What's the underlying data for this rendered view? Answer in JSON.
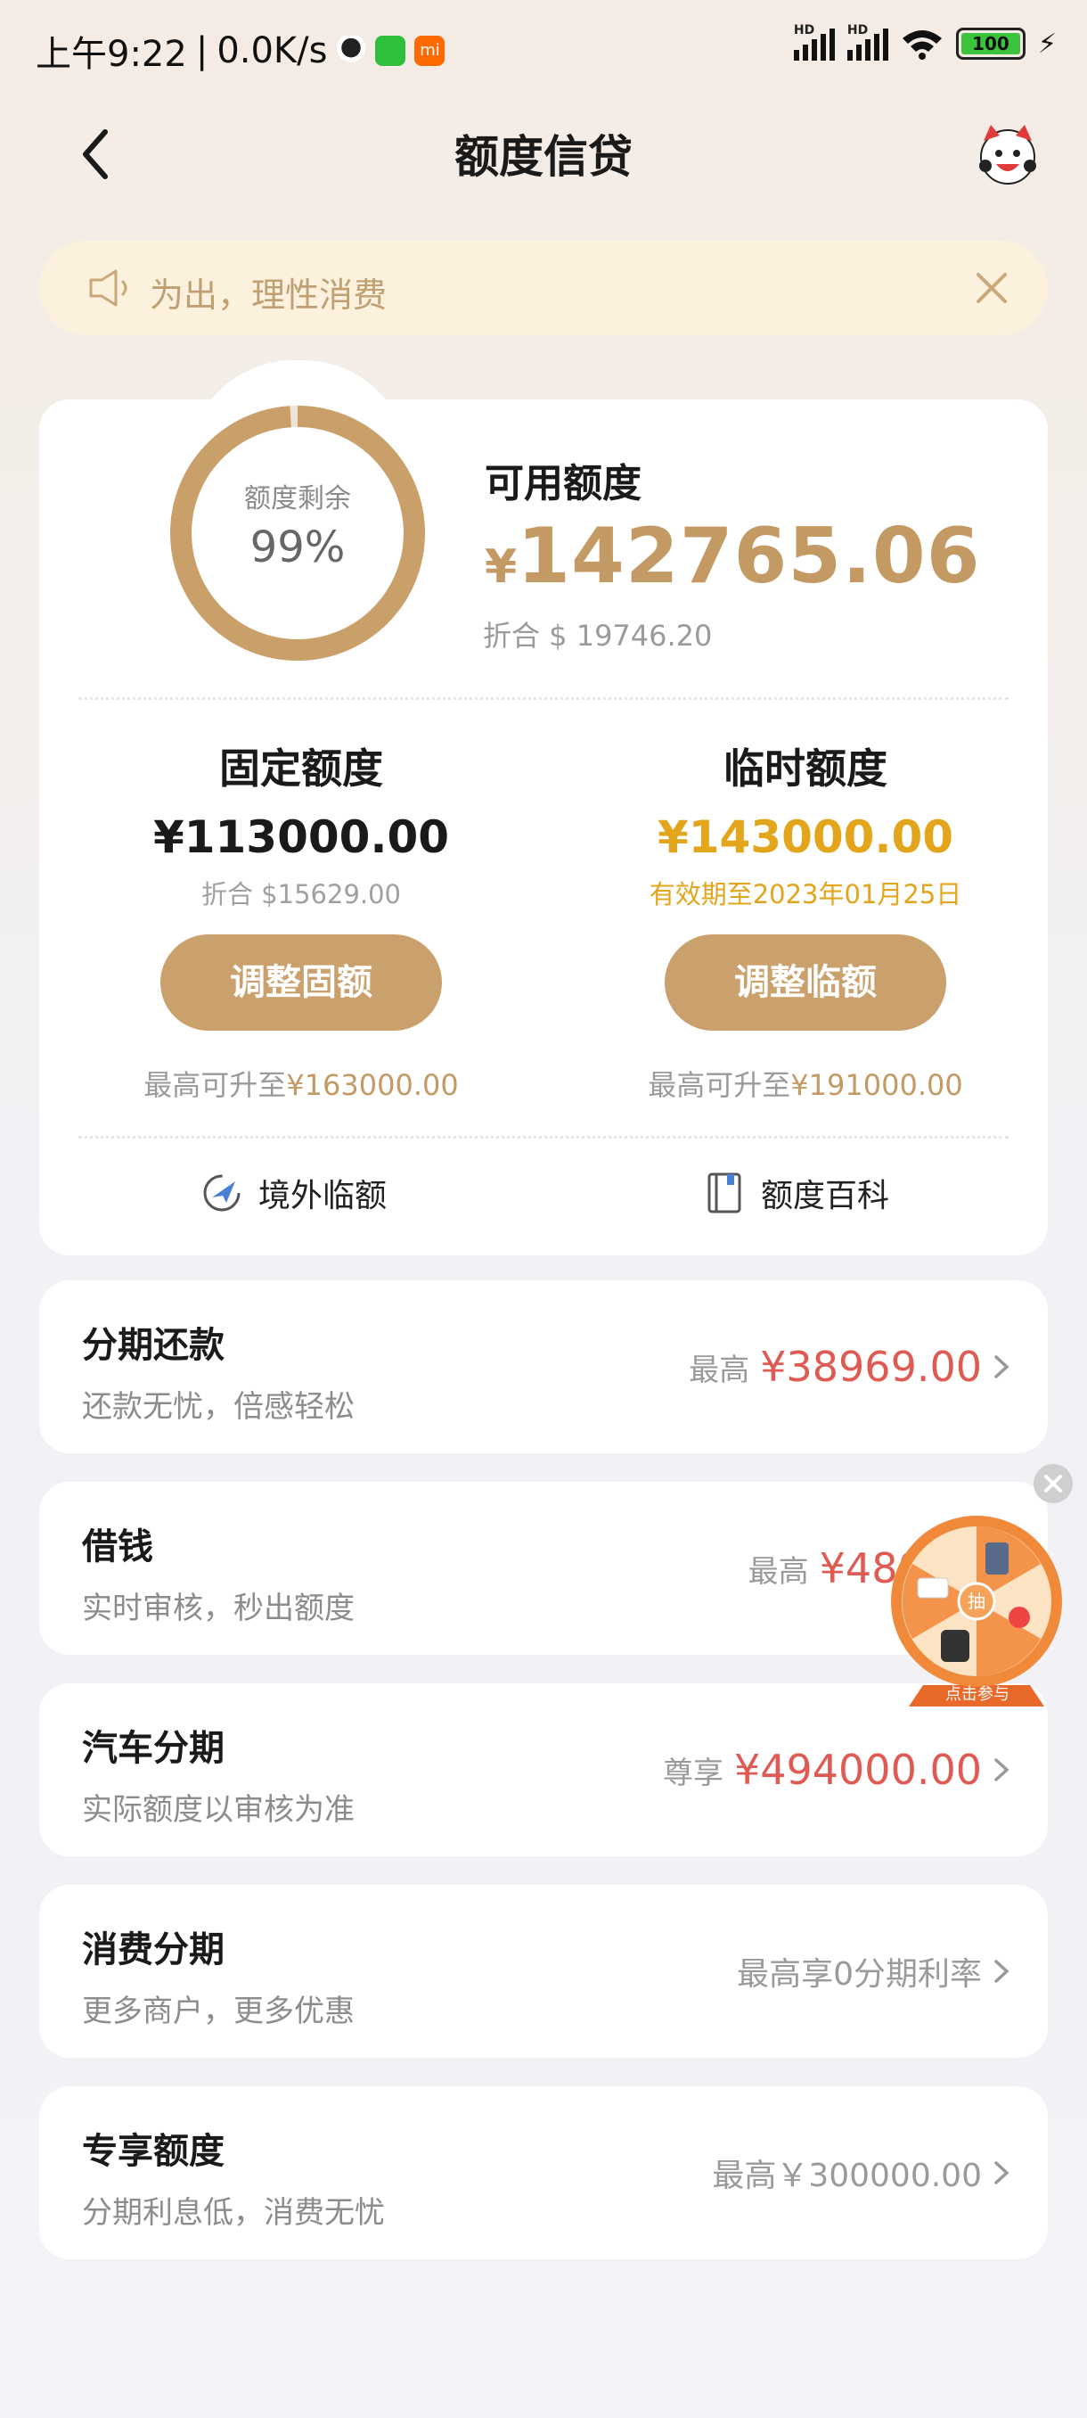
{
  "status_bar": {
    "time": "上午9:22",
    "speed": "0.0K/s",
    "battery": "100"
  },
  "header": {
    "title": "额度信贷"
  },
  "notice": {
    "text": "为出，理性消费"
  },
  "quota": {
    "ring_label": "额度剩余",
    "ring_percent": "99%",
    "ring_value": 0.99,
    "available_label": "可用额度",
    "available_currency": "¥",
    "available_amount": "142765.06",
    "available_usd": "折合 $ 19746.20",
    "fixed": {
      "title": "固定额度",
      "amount": "¥113000.00",
      "sub": "折合 $15629.00",
      "button": "调整固额",
      "max_prefix": "最高可升至",
      "max_value": "¥163000.00"
    },
    "temp": {
      "title": "临时额度",
      "amount": "¥143000.00",
      "sub": "有效期至2023年01月25日",
      "button": "调整临额",
      "max_prefix": "最高可升至",
      "max_value": "¥191000.00"
    },
    "links": [
      {
        "label": "境外临额",
        "icon": "plane-icon"
      },
      {
        "label": "额度百科",
        "icon": "book-icon"
      }
    ]
  },
  "items": [
    {
      "title": "分期还款",
      "desc": "还款无忧，倍感轻松",
      "prefix": "最高",
      "value": "¥38969.00"
    },
    {
      "title": "借钱",
      "desc": "实时审核，秒出额度",
      "prefix": "最高",
      "value": "¥4800"
    },
    {
      "title": "汽车分期",
      "desc": "实际额度以审核为准",
      "prefix": "尊享",
      "value": "¥494000.00"
    },
    {
      "title": "消费分期",
      "desc": "更多商户，更多优惠",
      "prefix": "",
      "value": "最高享0分期利率"
    },
    {
      "title": "专享额度",
      "desc": "分期利息低，消费无忧",
      "prefix": "",
      "value": "最高￥300000.00"
    }
  ],
  "wheel": {
    "center": "抽",
    "label": "点击参与"
  },
  "colors": {
    "gold": "#c49a64",
    "button": "#caa06c",
    "temp_amount": "#e3a51b",
    "red_value": "#e05a54"
  }
}
